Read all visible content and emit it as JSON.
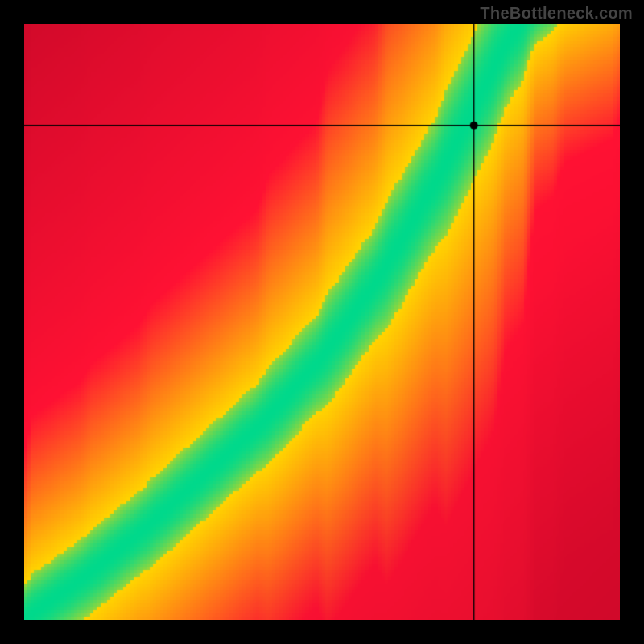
{
  "watermark": "TheBottleneck.com",
  "chart_data": {
    "type": "heatmap",
    "title": "",
    "xlabel": "",
    "ylabel": "",
    "xlim": [
      0,
      1
    ],
    "ylim": [
      0,
      1
    ],
    "color_scale": {
      "low": "#ff1133",
      "mid": "#ffd400",
      "high": "#00d98b",
      "description": "red = bottleneck, yellow = moderate, green = balanced"
    },
    "optimal_curve": [
      {
        "x": 0.0,
        "y": 0.0
      },
      {
        "x": 0.1,
        "y": 0.07
      },
      {
        "x": 0.2,
        "y": 0.15
      },
      {
        "x": 0.3,
        "y": 0.24
      },
      {
        "x": 0.4,
        "y": 0.33
      },
      {
        "x": 0.5,
        "y": 0.44
      },
      {
        "x": 0.6,
        "y": 0.58
      },
      {
        "x": 0.7,
        "y": 0.75
      },
      {
        "x": 0.75,
        "y": 0.85
      },
      {
        "x": 0.8,
        "y": 0.95
      },
      {
        "x": 0.85,
        "y": 1.03
      },
      {
        "x": 0.9,
        "y": 1.07
      },
      {
        "x": 1.0,
        "y": 1.12
      }
    ],
    "optimal_curve_halfwidth": 0.055,
    "yellow_halo_width": 0.22,
    "crosshair": {
      "x": 0.755,
      "y": 0.83
    },
    "marker": {
      "x": 0.755,
      "y": 0.83,
      "radius_px": 5
    },
    "resolution": 180
  }
}
